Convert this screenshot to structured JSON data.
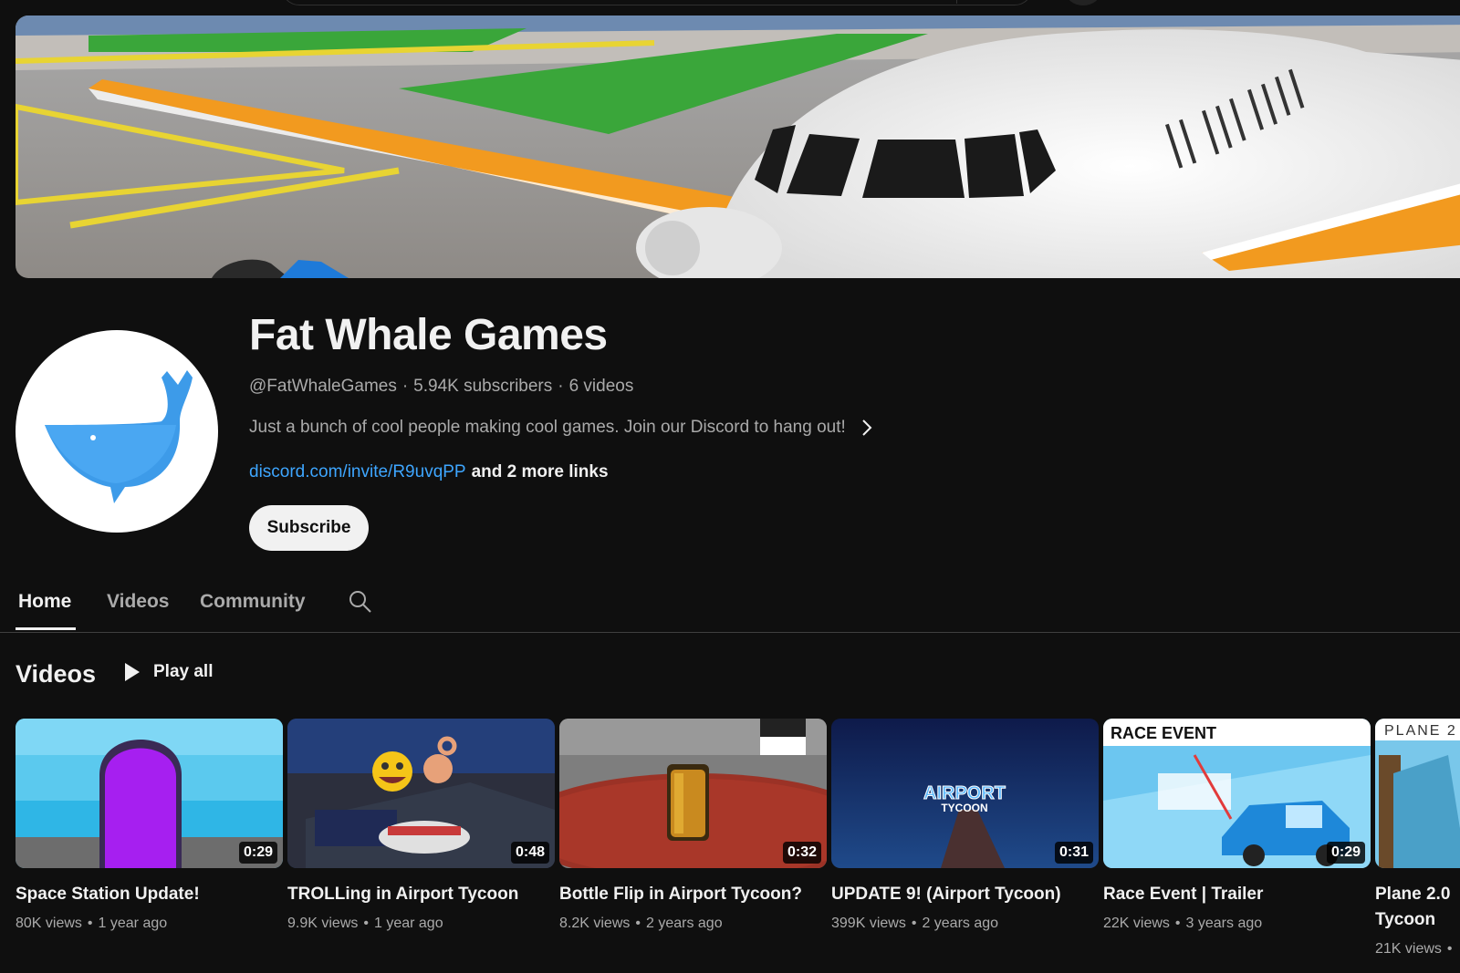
{
  "channel": {
    "name": "Fat Whale Games",
    "handle": "@FatWhaleGames",
    "subscribers": "5.94K subscribers",
    "video_count": "6 videos",
    "separator": "·",
    "description": "Just a bunch of cool people making cool games. Join our Discord to hang out!",
    "link": "discord.com/invite/R9uvqPP",
    "more_links": "and 2 more links",
    "subscribe_label": "Subscribe"
  },
  "tabs": [
    {
      "label": "Home",
      "active": true
    },
    {
      "label": "Videos",
      "active": false
    },
    {
      "label": "Community",
      "active": false
    }
  ],
  "section": {
    "title": "Videos",
    "play_all": "Play all"
  },
  "videos": [
    {
      "title": "Space Station Update!",
      "views": "80K views",
      "age": "1 year ago",
      "duration": "0:29"
    },
    {
      "title": "TROLLing in Airport Tycoon",
      "views": "9.9K views",
      "age": "1 year ago",
      "duration": "0:48"
    },
    {
      "title": "Bottle Flip in Airport Tycoon?",
      "views": "8.2K views",
      "age": "2 years ago",
      "duration": "0:32"
    },
    {
      "title": "UPDATE 9! (Airport Tycoon)",
      "views": "399K views",
      "age": "2 years ago",
      "duration": "0:31"
    },
    {
      "title": "Race Event | Trailer",
      "views": "22K views",
      "age": "3 years ago",
      "duration": "0:29"
    },
    {
      "title": "Plane 2.0 Tycoon",
      "views": "21K views",
      "age": "",
      "duration": ""
    }
  ],
  "meta_separator": "•",
  "thumb_text": {
    "race_event": "RACE EVENT",
    "plane": "PLANE 2",
    "airport": "AIRPORT",
    "tycoon": "TYCOON"
  },
  "colors": {
    "background": "#0f0f0f",
    "text_primary": "#f1f1f1",
    "text_secondary": "#aaaaaa",
    "link": "#3ea6ff",
    "whale": "#3d9be9"
  },
  "icons": {
    "chevron": "chevron-right-icon",
    "search": "search-icon",
    "play": "play-icon",
    "whale": "whale-logo"
  }
}
